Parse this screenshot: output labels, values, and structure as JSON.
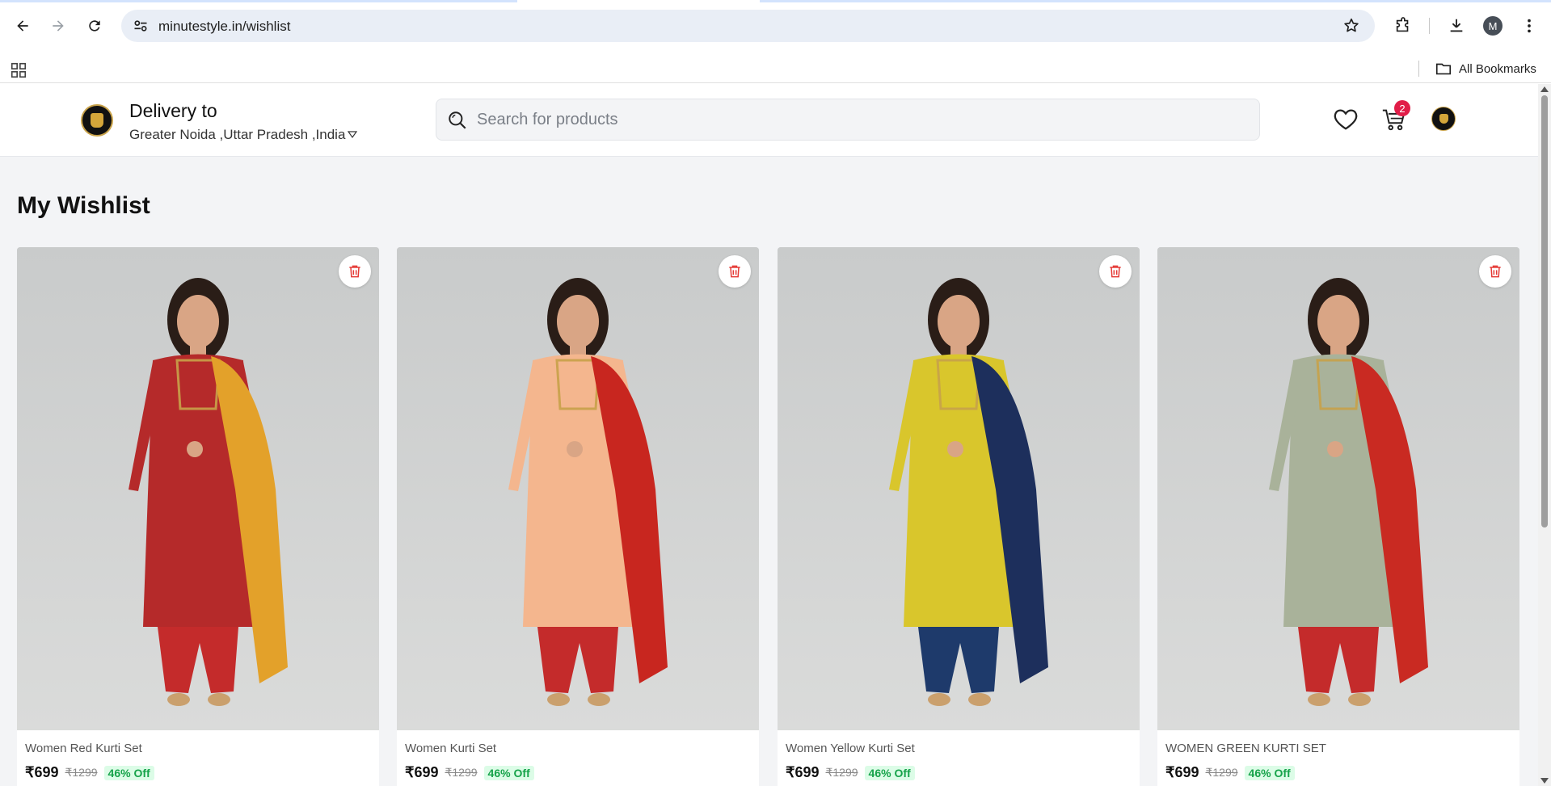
{
  "browser": {
    "url": "minutestyle.in/wishlist",
    "profile_initial": "M",
    "bookmarks_label": "All Bookmarks"
  },
  "header": {
    "delivery_title": "Delivery to",
    "delivery_location": "Greater Noida ,Uttar Pradesh ,India",
    "search_placeholder": "Search for products",
    "cart_count": "2"
  },
  "wishlist": {
    "title": "My Wishlist",
    "items": [
      {
        "name": "Women Red Kurti Set",
        "price": "₹699",
        "mrp": "₹1299",
        "discount": "46% Off",
        "kurta_color": "#b52a2a",
        "dupatta_color": "#e3a12a",
        "pants_color": "#c42b2b"
      },
      {
        "name": "Women Kurti Set",
        "price": "₹699",
        "mrp": "₹1299",
        "discount": "46% Off",
        "kurta_color": "#f4b68e",
        "dupatta_color": "#c8261f",
        "pants_color": "#c42b2b"
      },
      {
        "name": "Women Yellow Kurti Set",
        "price": "₹699",
        "mrp": "₹1299",
        "discount": "46% Off",
        "kurta_color": "#d9c62c",
        "dupatta_color": "#1d2f5c",
        "pants_color": "#1e3a6b"
      },
      {
        "name": "WOMEN GREEN KURTI SET",
        "price": "₹699",
        "mrp": "₹1299",
        "discount": "46% Off",
        "kurta_color": "#a9b29a",
        "dupatta_color": "#c92a22",
        "pants_color": "#c42b2b"
      }
    ]
  },
  "colors": {
    "discount_green": "#16a34a",
    "badge_red": "#e11d48",
    "delete_red": "#e53935"
  }
}
